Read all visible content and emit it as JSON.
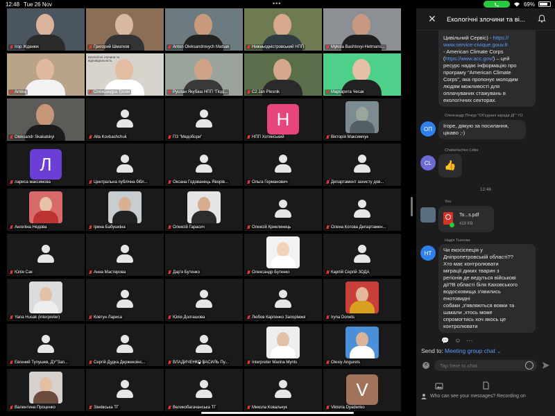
{
  "status": {
    "time": "12:48",
    "date": "Tue 26 Nov",
    "battery": "69%",
    "colors": {
      "call_pill": "#27c93f"
    }
  },
  "tiles": [
    {
      "name": "Ігор Жданюк",
      "kind": "video",
      "bg": "#4a5560",
      "skin": "#d9b39a",
      "cloth": "#2b2b2b"
    },
    {
      "name": "Григорий Шматков",
      "kind": "video",
      "bg": "#8a6e55",
      "skin": "#d8b8a0",
      "cloth": "#333"
    },
    {
      "name": "Anton Oleksandrovych Matsak",
      "kind": "video",
      "bg": "#6b7b80",
      "skin": "#c99b7c",
      "cloth": "#222"
    },
    {
      "name": "Нижньодністровський НПП",
      "kind": "video",
      "bg": "#6e7a52",
      "skin": "#d6a98c",
      "cloth": "#2f3b40"
    },
    {
      "name": "Mykola Bashtovyi-Hetmans...",
      "kind": "video",
      "bg": "#8c8f94",
      "skin": "#c99880",
      "cloth": "#1e1e1e"
    },
    {
      "name": "Amika",
      "kind": "video",
      "bg": "#b9a48a",
      "skin": "#e0b9a0",
      "cloth": "#f2f2f2"
    },
    {
      "name": "Олександра Троян",
      "kind": "video",
      "bg": "#d7d4cd",
      "skin": "#e2bda2",
      "cloth": "#ffffff",
      "screen_text": "Екологічні злочини та відповідальність"
    },
    {
      "name": "Руслан Якубаш НПП \"Поді...",
      "kind": "video",
      "bg": "#9aa49d",
      "skin": "#d1a386",
      "cloth": "#3a3a3a"
    },
    {
      "name": "C2 Jan Plesnik",
      "kind": "video",
      "bg": "#5a6e4a",
      "skin": "#d5a78d",
      "cloth": "#2a2a2a"
    },
    {
      "name": "Маргарита Чесак",
      "kind": "video",
      "bg": "#4ed08a",
      "skin": "#e6c0a6",
      "cloth": "#222"
    },
    {
      "name": "Oleksandr Skakalskyi",
      "kind": "video",
      "active": true,
      "bg": "#5d5b58",
      "skin": "#c69679",
      "cloth": "#1b1b1b"
    },
    {
      "name": "Alla Kovbashchuk",
      "kind": "avatar"
    },
    {
      "name": "ПЗ \"Медобори\"",
      "kind": "avatar"
    },
    {
      "name": "НПП Хотинський",
      "kind": "letter",
      "letter": "Н",
      "color": "#e8457a"
    },
    {
      "name": "Вікторія Максимчук",
      "kind": "photo",
      "bg": "#7d8c92",
      "skin": "#9ba59c",
      "cloth": "#556066"
    },
    {
      "name": "лариса максимова",
      "kind": "letter",
      "letter": "Л",
      "color": "#6b3fd6"
    },
    {
      "name": "Центральна публічна бібл...",
      "kind": "avatar"
    },
    {
      "name": "Оксана Годованець Яворів...",
      "kind": "avatar"
    },
    {
      "name": "Ольга Германович",
      "kind": "avatar"
    },
    {
      "name": "Департамент захисту дов...",
      "kind": "avatar"
    },
    {
      "name": "Ангеліна Недова",
      "kind": "photo",
      "bg": "#d96a6a",
      "skin": "#e8c2a8",
      "cloth": "#b33"
    },
    {
      "name": "Ірина Бабушкіна",
      "kind": "photo",
      "bg": "#c8cdd2",
      "skin": "#d8b094",
      "cloth": "#222"
    },
    {
      "name": "Олексій Гарасич",
      "kind": "photo",
      "bg": "#e5e5e5",
      "skin": "#d7ab8e",
      "cloth": "#2c2c2c"
    },
    {
      "name": "Олексій Криклинець",
      "kind": "avatar"
    },
    {
      "name": "Олена Котова Департамен...",
      "kind": "avatar"
    },
    {
      "name": "Юлія Сак",
      "kind": "avatar"
    },
    {
      "name": "Анна Мастерова",
      "kind": "avatar"
    },
    {
      "name": "Дар'я Бутенко",
      "kind": "blank"
    },
    {
      "name": "Олександр Бутенко",
      "kind": "photo",
      "bg": "#f2f2f2",
      "skin": "#f0d2b8",
      "cloth": "#ffffff"
    },
    {
      "name": "Карпій Сергій ЗОДА",
      "kind": "avatar"
    },
    {
      "name": "Yana Husak (interpreter)",
      "kind": "photo",
      "bg": "#dcdcdc",
      "skin": "#e0c2aa",
      "cloth": "#eeeeee"
    },
    {
      "name": "Ковтун Лариса",
      "kind": "avatar"
    },
    {
      "name": "Юлія Долгашова",
      "kind": "avatar"
    },
    {
      "name": "Любов Карпенко Запоріжжя",
      "kind": "avatar"
    },
    {
      "name": "Iryna Donets",
      "kind": "photo",
      "bg": "#c9403a",
      "skin": "#e3b89c",
      "cloth": "#d9a020"
    },
    {
      "name": "Евгений Тулушев, ДУ\"Зап...",
      "kind": "avatar"
    },
    {
      "name": "Сергій Дудка Держекоінс...",
      "kind": "avatar"
    },
    {
      "name": "ВЛАДИЧЕНКО ВАСИЛЬ Пу...",
      "kind": "avatar"
    },
    {
      "name": "Interpreter Marina Mynts",
      "kind": "photo",
      "bg": "#eeeeee",
      "skin": "#e4c0a4",
      "cloth": "#ffffff"
    },
    {
      "name": "Olexiy Angurets",
      "kind": "photo",
      "bg": "#4a90d9",
      "skin": "#dcb298",
      "cloth": "#ffffff"
    },
    {
      "name": "Валентина Проценко",
      "kind": "photo",
      "bg": "#d6d1cc",
      "skin": "#e3bfa4",
      "cloth": "#6b4b3c"
    },
    {
      "name": "Зінківська ТГ",
      "kind": "avatar"
    },
    {
      "name": "Великобагачанська ТГ",
      "kind": "avatar"
    },
    {
      "name": "Микола Ковальчук",
      "kind": "avatar"
    },
    {
      "name": "Viktoria Dyadenko",
      "kind": "letter",
      "letter": "V",
      "color": "#a0735a"
    }
  ],
  "chat": {
    "title": "Екологічні злочини та ві...",
    "msg1_lines": [
      "Цивільний Сервіс) - ",
      "https://",
      "www.service-civique.gouv.fr",
      "- American Climate Corps",
      "(https://www.acc.gov/) – цей",
      "ресурс надає інформацію про",
      "програму \"American Climate",
      "Corps\", яка пропонує молодим",
      "людям можливості для",
      "оплачуваних стажувань в",
      "екологічних секторах."
    ],
    "msg1_link_a": "https://",
    "msg1_link_b": "www.service-civique.gouv.fr",
    "msg1_link_c": "https://www.acc.gov/",
    "sender2": "Олександр Пічкур \"Об'єднані заради ДГ\" ГО",
    "initials2": "ОП",
    "msg2": "Ігоре, дякую за посилання, цікаво ;-)",
    "sender3": "Chaberlachko Lidiia",
    "initials3": "CL",
    "msg3": "👍",
    "timestamp": "12:46",
    "sender_you": "You",
    "file_name": "To...s.pdf",
    "file_size": "419 KB",
    "sender4": "Надія Ткачова",
    "initials4": "НТ",
    "msg4_lines": [
      "Чи екосіспеція у",
      "Дніпропетровській області??",
      "Хто має контролювати",
      "міграції диких тварин з",
      "регіонів де ведуться військові",
      "дії?В області біля Каховського",
      "водосховища з'явились",
      "енотовидні",
      "собаки ,з'являються вовки та",
      "шакали ,хтось може",
      "спромогтись хоч якось це",
      "контролювати"
    ],
    "send_to_label": "Send to:",
    "send_to_target": "Meeting group chat",
    "input_placeholder": "Tap here to chat",
    "privacy": "Who can see your messages? Recording on",
    "colors": {
      "op": "#2f80ed",
      "cl": "#6b6bd6",
      "nt": "#2f80ed"
    }
  }
}
